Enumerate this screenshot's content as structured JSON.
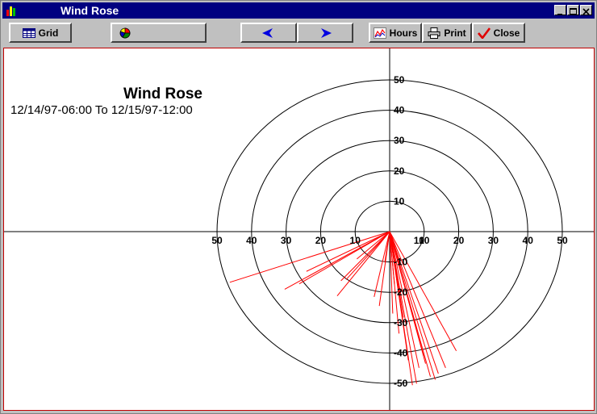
{
  "window": {
    "title": "Wind Rose"
  },
  "toolbar": {
    "grid_label": "Grid",
    "hours_label": "Hours",
    "print_label": "Print",
    "close_label": "Close"
  },
  "colors": {
    "titlebar": "#000080",
    "rays": "#ff0000",
    "rings": "#000000"
  },
  "chart_data": {
    "type": "polar-radial",
    "title": "Wind Rose",
    "subtitle": "12/14/97-06:00 To 12/15/97-12:00",
    "rings": [
      10,
      20,
      30,
      40,
      50
    ],
    "x_ticks_left": [
      "50",
      "40",
      "30",
      "20",
      "10"
    ],
    "x_ticks_right": [
      "10",
      "10",
      "20",
      "30",
      "40",
      "50"
    ],
    "y_ticks_top": [
      "50",
      "40",
      "30",
      "20",
      "10"
    ],
    "y_ticks_bottom": [
      "-10",
      "-20",
      "-30",
      "-40",
      "-50"
    ],
    "rays": [
      {
        "dx": -46.3,
        "dy": -16.7
      },
      {
        "dx": -30.4,
        "dy": -19.0
      },
      {
        "dx": -26.2,
        "dy": -17.2
      },
      {
        "dx": -24.1,
        "dy": -13.1
      },
      {
        "dx": -15.2,
        "dy": -21.2
      },
      {
        "dx": -14.1,
        "dy": -16.2
      },
      {
        "dx": -12.6,
        "dy": -15.8
      },
      {
        "dx": -9.5,
        "dy": -9.0
      },
      {
        "dx": -4.5,
        "dy": -21.5
      },
      {
        "dx": -3.0,
        "dy": -24.5
      },
      {
        "dx": -1.4,
        "dy": -10.1
      },
      {
        "dx": 0.9,
        "dy": -27.0
      },
      {
        "dx": 1.4,
        "dy": -17.5
      },
      {
        "dx": 2.7,
        "dy": -33.6
      },
      {
        "dx": 4.0,
        "dy": -28.3
      },
      {
        "dx": 5.4,
        "dy": -42.4
      },
      {
        "dx": 6.6,
        "dy": -50.6
      },
      {
        "dx": 7.8,
        "dy": -50.1
      },
      {
        "dx": 8.5,
        "dy": -44.9
      },
      {
        "dx": 9.8,
        "dy": -40.9
      },
      {
        "dx": 10.4,
        "dy": -43.5
      },
      {
        "dx": 11.8,
        "dy": -47.8
      },
      {
        "dx": 13.2,
        "dy": -48.8
      },
      {
        "dx": 14.1,
        "dy": -46.8
      },
      {
        "dx": 16.2,
        "dy": -44.9
      },
      {
        "dx": 19.3,
        "dy": -39.3
      },
      {
        "dx": 0.5,
        "dy": -4.2
      }
    ]
  }
}
